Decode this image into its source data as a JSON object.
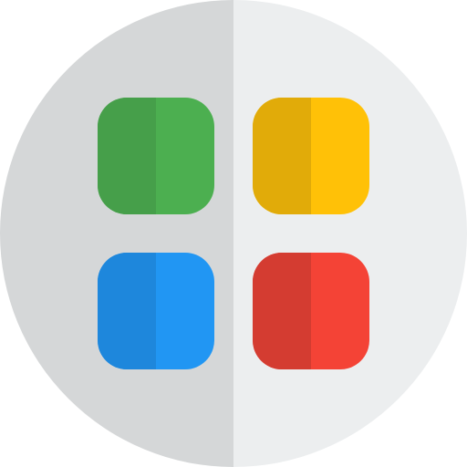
{
  "icon": {
    "name": "app-grid-icon",
    "background": {
      "left_half": "#d5d7d8",
      "right_half": "#eceeef"
    },
    "tiles": [
      {
        "name": "tile-green-icon",
        "color": "#4caf50",
        "shade": "#469f4a"
      },
      {
        "name": "tile-yellow-icon",
        "color": "#ffc107",
        "shade": "#e1ab09"
      },
      {
        "name": "tile-blue-icon",
        "color": "#2196f3",
        "shade": "#1e87dc"
      },
      {
        "name": "tile-red-icon",
        "color": "#f44336",
        "shade": "#d43c31"
      }
    ]
  }
}
